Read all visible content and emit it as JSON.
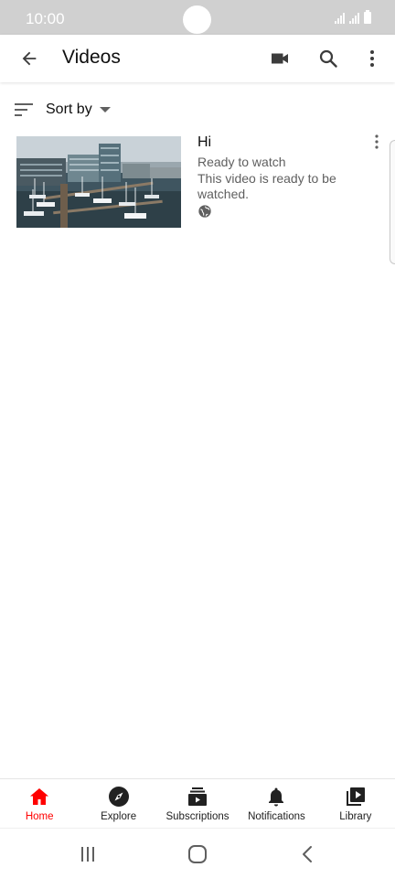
{
  "status_bar": {
    "time": "10:00"
  },
  "app_bar": {
    "title": "Videos",
    "icons": [
      "back-arrow-icon",
      "video-camera-icon",
      "search-icon",
      "more-vert-icon"
    ]
  },
  "sort": {
    "label": "Sort by"
  },
  "videos": [
    {
      "title": "Hi",
      "status": "Ready to watch",
      "description": "This video is ready to be watched.",
      "visibility_icon": "globe-icon"
    }
  ],
  "bottom_nav": {
    "items": [
      {
        "label": "Home",
        "icon": "home-icon",
        "active": true
      },
      {
        "label": "Explore",
        "icon": "compass-icon",
        "active": false
      },
      {
        "label": "Subscriptions",
        "icon": "subscriptions-icon",
        "active": false
      },
      {
        "label": "Notifications",
        "icon": "bell-icon",
        "active": false
      },
      {
        "label": "Library",
        "icon": "library-icon",
        "active": false
      }
    ]
  },
  "system_nav": {
    "icons": [
      "recents-icon",
      "home-circle-icon",
      "back-chevron-icon"
    ]
  },
  "colors": {
    "accent": "#ff0000",
    "status_bar": "#d0d0d0",
    "secondary_text": "#606060"
  }
}
